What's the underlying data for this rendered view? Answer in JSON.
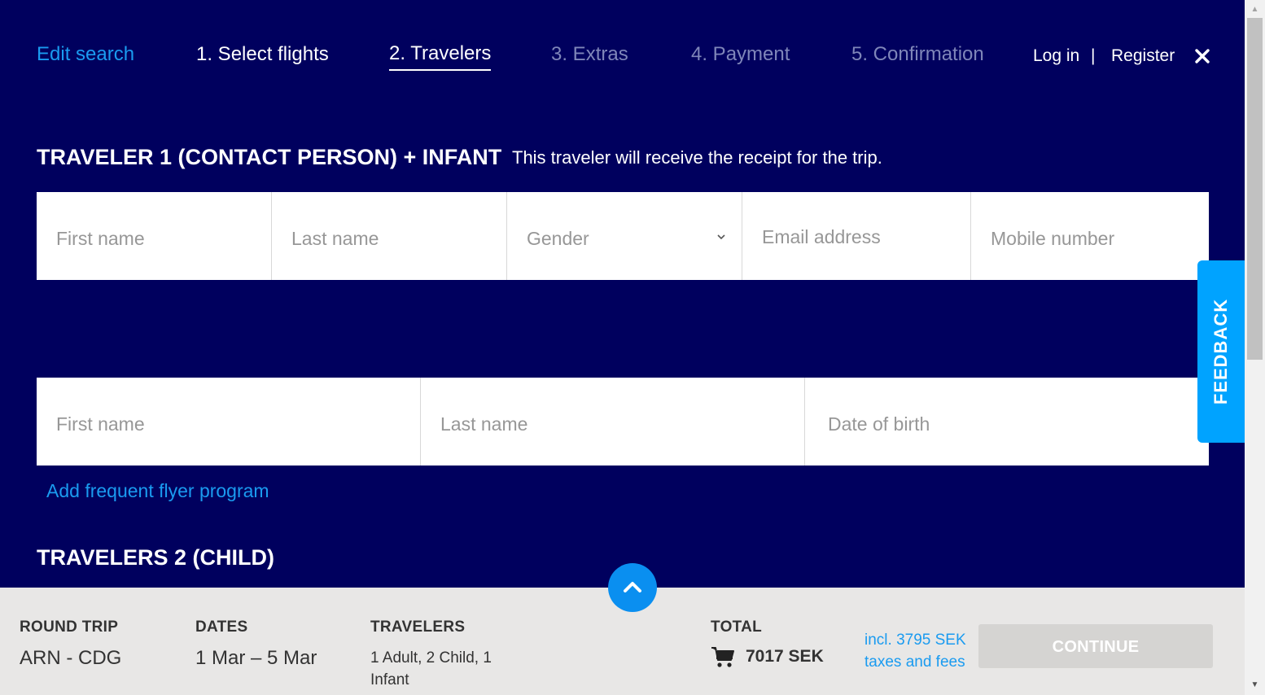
{
  "nav": {
    "edit_search": "Edit search",
    "steps": [
      {
        "label": "1. Select flights",
        "state": "done"
      },
      {
        "label": "2. Travelers",
        "state": "active"
      },
      {
        "label": "3. Extras",
        "state": "disabled"
      },
      {
        "label": "4. Payment",
        "state": "disabled"
      },
      {
        "label": "5. Confirmation",
        "state": "disabled"
      }
    ],
    "login": "Log in",
    "separator": "|",
    "register": "Register",
    "close_icon": "close-icon"
  },
  "traveler1": {
    "title": "TRAVELER 1 (CONTACT PERSON) + INFANT",
    "subtitle": "This traveler will receive the receipt for the trip.",
    "fields": {
      "first_name": "First name",
      "last_name": "Last name",
      "gender": "Gender",
      "email": "Email address",
      "mobile": "Mobile number"
    }
  },
  "infant": {
    "fields": {
      "first_name": "First name",
      "last_name": "Last name",
      "dob": "Date of birth"
    }
  },
  "frequent_flyer_link": "Add frequent flyer program",
  "traveler2": {
    "title": "TRAVELERS 2 (CHILD)"
  },
  "feedback": "FEEDBACK",
  "summary": {
    "trip_label": "ROUND TRIP",
    "trip_value": "ARN - CDG",
    "dates_label": "DATES",
    "dates_value": "1 Mar – 5 Mar",
    "travelers_label": "TRAVELERS",
    "travelers_value": "1 Adult, 2 Child, 1 Infant",
    "total_label": "TOTAL",
    "total_value": "7017 SEK",
    "tax_note": "incl. 3795 SEK taxes and fees",
    "continue": "CONTINUE"
  },
  "colors": {
    "background": "#00005e",
    "link": "#1a9bf0",
    "feedback": "#00a3ff",
    "summary_bg": "#e8e7e6",
    "continue_disabled": "#d5d4d2"
  }
}
